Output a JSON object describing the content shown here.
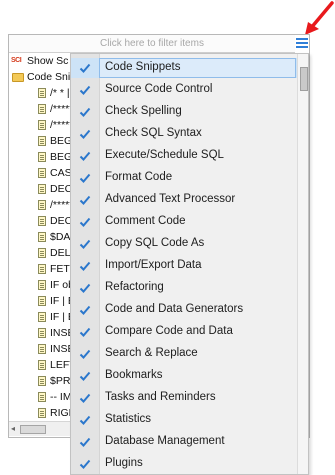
{
  "annotation": {
    "arrow_color": "#e8191c"
  },
  "filter": {
    "placeholder": "Click here to filter items",
    "menu_icon": "hamburger-menu-icon",
    "menu_icon_color": "#2f7fd8"
  },
  "tree": {
    "items": [
      {
        "label": "Show Sc",
        "icon": "sci-icon"
      },
      {
        "label": "Code Sni",
        "icon": "folder-icon"
      },
      {
        "label": "/* * |",
        "icon": "doc-icon"
      },
      {
        "label": "/*****",
        "icon": "doc-icon"
      },
      {
        "label": "/*****",
        "icon": "doc-icon"
      },
      {
        "label": "BEG",
        "icon": "doc-icon"
      },
      {
        "label": "BEG",
        "icon": "doc-icon"
      },
      {
        "label": "CAS",
        "icon": "doc-icon"
      },
      {
        "label": "DEC",
        "icon": "doc-icon"
      },
      {
        "label": "/*****",
        "icon": "doc-icon"
      },
      {
        "label": "DEC",
        "icon": "doc-icon"
      },
      {
        "label": "$DA",
        "icon": "doc-icon"
      },
      {
        "label": "DELI",
        "icon": "doc-icon"
      },
      {
        "label": "FETC",
        "icon": "doc-icon"
      },
      {
        "label": "IF ob",
        "icon": "doc-icon"
      },
      {
        "label": "IF | E",
        "icon": "doc-icon"
      },
      {
        "label": "IF | E",
        "icon": "doc-icon"
      },
      {
        "label": "INSE",
        "icon": "doc-icon"
      },
      {
        "label": "INSE",
        "icon": "doc-icon"
      },
      {
        "label": "LEFT",
        "icon": "doc-icon"
      },
      {
        "label": "$PRO",
        "icon": "doc-icon"
      },
      {
        "label": "-- IM",
        "icon": "doc-icon"
      },
      {
        "label": "RIGH",
        "icon": "doc-icon"
      }
    ]
  },
  "menu": {
    "check_color": "#2b77cc",
    "active_index": 0,
    "items": [
      {
        "label": "Code Snippets",
        "checked": true
      },
      {
        "label": "Source Code Control",
        "checked": true
      },
      {
        "label": "Check Spelling",
        "checked": true
      },
      {
        "label": "Check SQL Syntax",
        "checked": true
      },
      {
        "label": "Execute/Schedule SQL",
        "checked": true
      },
      {
        "label": "Format Code",
        "checked": true
      },
      {
        "label": "Advanced Text Processor",
        "checked": true
      },
      {
        "label": "Comment Code",
        "checked": true
      },
      {
        "label": "Copy SQL Code As",
        "checked": true
      },
      {
        "label": "Import/Export Data",
        "checked": true
      },
      {
        "label": "Refactoring",
        "checked": true
      },
      {
        "label": "Code and Data Generators",
        "checked": true
      },
      {
        "label": "Compare Code and Data",
        "checked": true
      },
      {
        "label": "Search & Replace",
        "checked": true
      },
      {
        "label": "Bookmarks",
        "checked": true
      },
      {
        "label": "Tasks and Reminders",
        "checked": true
      },
      {
        "label": "Statistics",
        "checked": true
      },
      {
        "label": "Database Management",
        "checked": true
      },
      {
        "label": "Plugins",
        "checked": true
      }
    ]
  }
}
